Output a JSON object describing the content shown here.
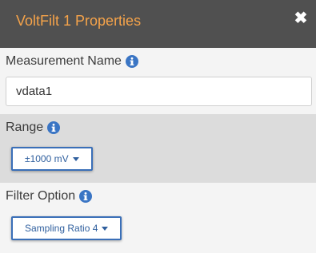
{
  "header": {
    "title": "VoltFilt 1 Properties",
    "close_glyph": "✖",
    "close_icon": "close-icon"
  },
  "measurement_name": {
    "label": "Measurement Name",
    "info_icon": "info-icon",
    "value": "vdata1"
  },
  "range": {
    "label": "Range",
    "info_icon": "info-icon",
    "selected": "±1000 mV"
  },
  "filter_option": {
    "label": "Filter Option",
    "info_icon": "info-icon",
    "selected": "Sampling Ratio 4"
  },
  "colors": {
    "header_bg": "#505050",
    "title": "#f5a34a",
    "accent": "#3a75c4",
    "range_section_bg": "#dcdcdc"
  }
}
